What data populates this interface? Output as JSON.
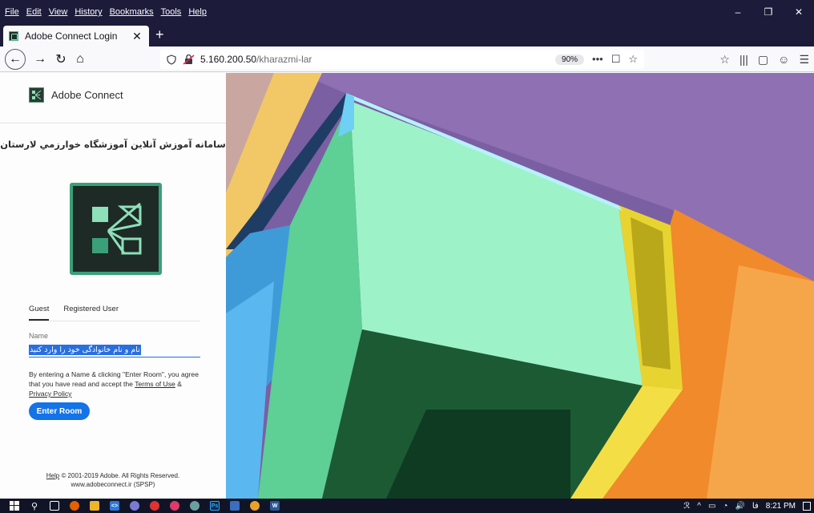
{
  "menu": [
    "File",
    "Edit",
    "View",
    "History",
    "Bookmarks",
    "Tools",
    "Help"
  ],
  "window_controls": {
    "minimize": "–",
    "restore": "❐",
    "close": "✕"
  },
  "tab": {
    "title": "Adobe Connect Login",
    "close": "✕",
    "new_tab": "+"
  },
  "toolbar": {
    "back": "←",
    "forward": "→",
    "reload": "↻",
    "home": "⌂",
    "url_host": "5.160.200.50",
    "url_path": "/kharazmi-lar",
    "zoom": "90%",
    "page_actions": "•••",
    "pocket": "☐",
    "bookmark": "☆",
    "right_icons": [
      "☆",
      "|||",
      "▢",
      "☺",
      "☰"
    ]
  },
  "login": {
    "brand": "Adobe Connect",
    "room_title": "سامانه آموزش آنلاین آموزشگاه خوارزمي لارستان",
    "tabs": [
      "Guest",
      "Registered User"
    ],
    "name_label": "Name",
    "name_value": "نام و نام خانوادگی خود را وارد کنید",
    "agree_text": "By entering a Name & clicking \"Enter Room\", you agree that you have read and accept the ",
    "terms_link": "Terms of Use",
    "amp": " & ",
    "privacy_link": "Privacy Policy",
    "enter_button": "Enter Room",
    "footer_help": "Help",
    "footer_copyright": " © 2001-2019 Adobe. All Rights Reserved.",
    "footer_site": "www.adobeconnect.ir (SPSP)"
  },
  "taskbar": {
    "lang": "فا",
    "time": "8:21 PM",
    "tray": [
      "ℛ",
      "^",
      "▭",
      "◔",
      "🔊"
    ]
  },
  "colors": {
    "chrome_dark": "#1c1b3a",
    "accent": "#1473e6",
    "logo_green": "#3aa079"
  }
}
